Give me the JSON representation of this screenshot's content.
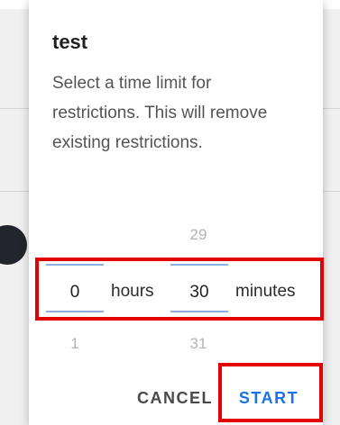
{
  "dialog": {
    "title": "test",
    "message": "Select a time limit for restrictions. This will remove existing restrictions."
  },
  "picker": {
    "hours": {
      "above": "",
      "value": "0",
      "below": "1",
      "label": "hours"
    },
    "minutes": {
      "above": "29",
      "value": "30",
      "below": "31",
      "label": "minutes"
    }
  },
  "buttons": {
    "cancel": "CANCEL",
    "start": "START"
  },
  "colors": {
    "accent": "#1a73e8",
    "highlight": "#e30000",
    "picker_divider": "#8fb0df"
  }
}
